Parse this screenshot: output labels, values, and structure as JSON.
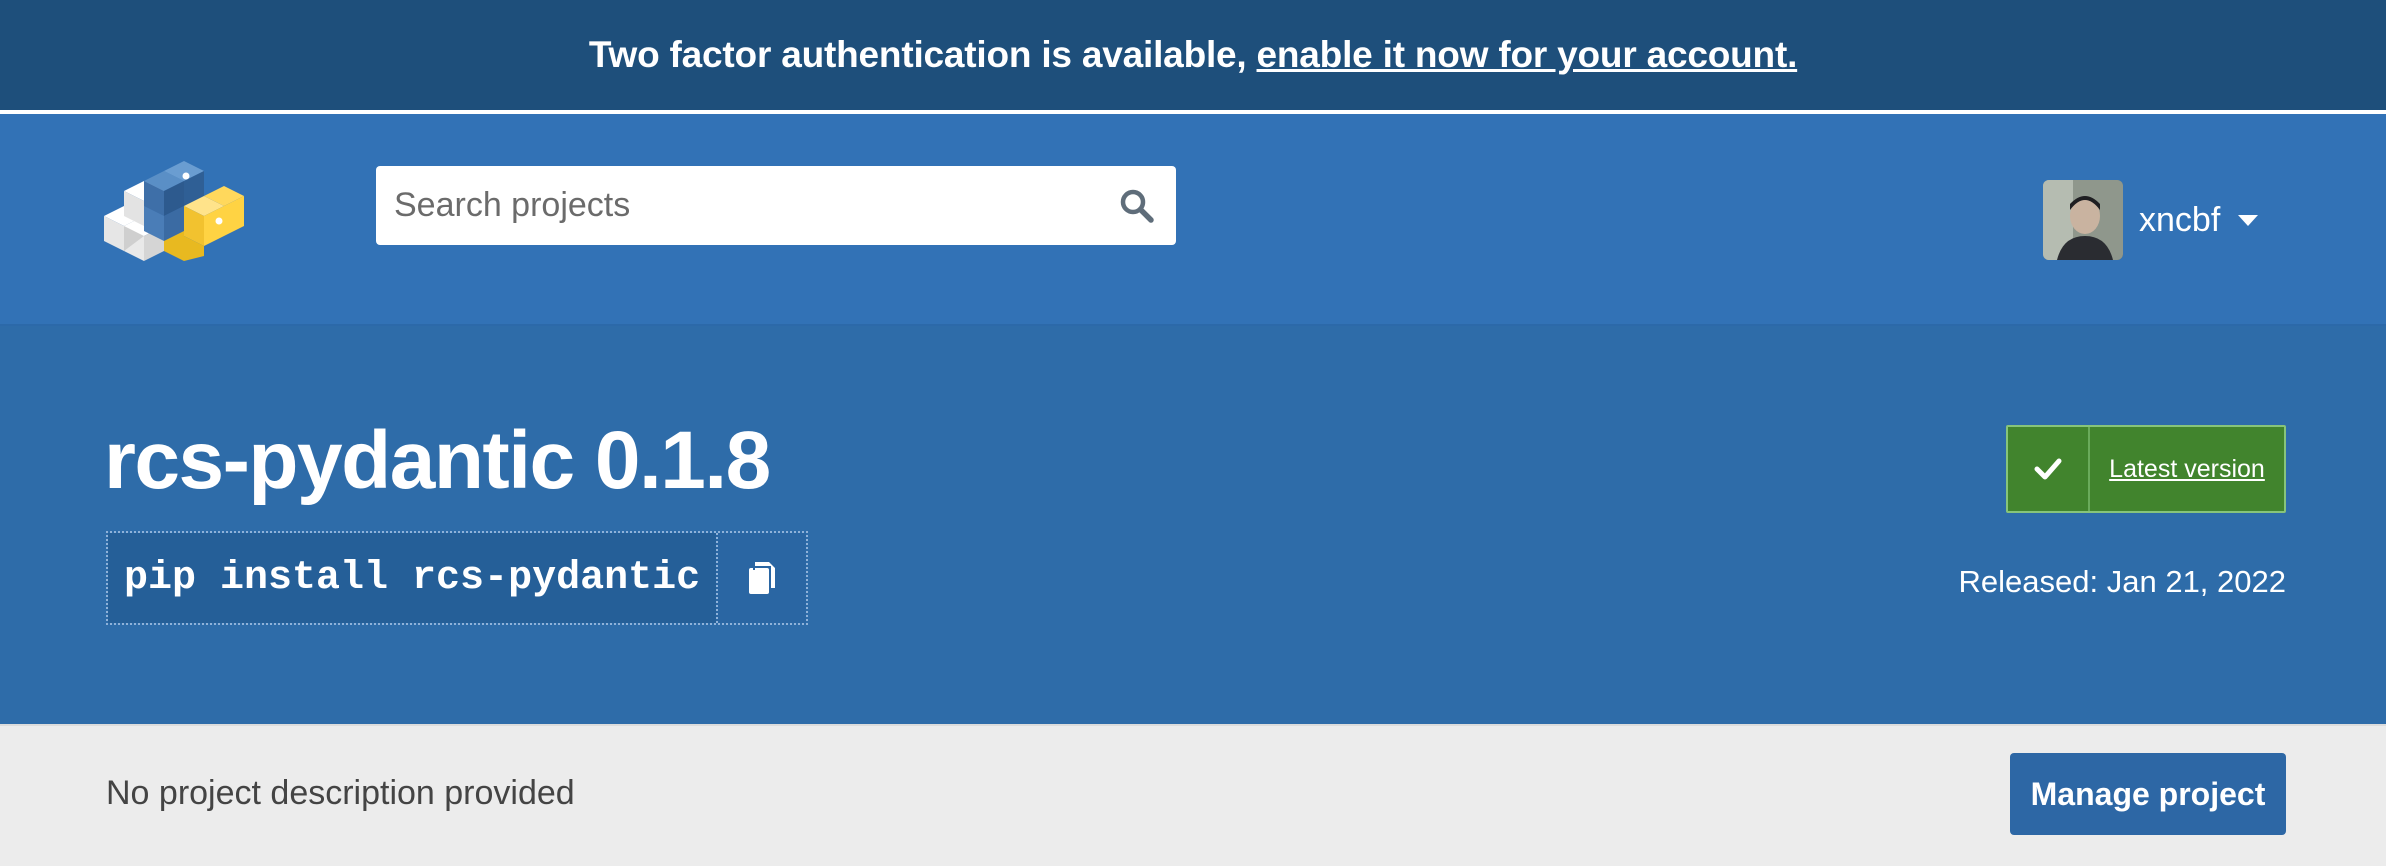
{
  "notice": {
    "text": "Two factor authentication is available,",
    "link_text": "enable it now for your account."
  },
  "header": {
    "logo": "pypi-logo",
    "search": {
      "placeholder": "Search projects",
      "value": ""
    },
    "user": {
      "username": "xncbf"
    }
  },
  "project": {
    "title": "rcs-pydantic 0.1.8",
    "pip_command": "pip install rcs-pydantic",
    "latest_badge": "Latest version",
    "released": "Released: Jan 21, 2022",
    "description": "No project description provided",
    "manage_label": "Manage project"
  },
  "colors": {
    "notice_bg": "#1e4f7b",
    "header_bg": "#3272b6",
    "hero_bg": "#2e6ca9",
    "badge_green": "#41842d",
    "manage_button": "#2d67a5"
  },
  "icons": {
    "search": "search-icon",
    "copy": "copy-icon",
    "check": "check-icon",
    "caret": "caret-down-icon"
  }
}
